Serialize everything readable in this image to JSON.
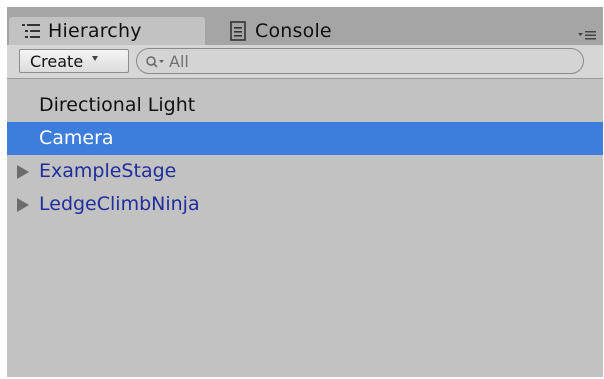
{
  "tabs": [
    {
      "label": "Hierarchy",
      "icon": "list-icon",
      "active": true
    },
    {
      "label": "Console",
      "icon": "console-icon",
      "active": false
    }
  ],
  "panel_menu": {
    "icon": "panel-menu-icon"
  },
  "toolbar": {
    "create_label": "Create",
    "search": {
      "placeholder": "All",
      "value": "",
      "icon": "search-icon"
    }
  },
  "tree": [
    {
      "label": "Directional Light",
      "state": "normal",
      "expandable": false
    },
    {
      "label": "Camera",
      "state": "selected",
      "expandable": false
    },
    {
      "label": "ExampleStage",
      "state": "prefab",
      "expandable": true
    },
    {
      "label": "LedgeClimbNinja",
      "state": "prefab",
      "expandable": true
    }
  ],
  "colors": {
    "panel_bg": "#c2c2c2",
    "tabstrip_bg": "#a5a5a5",
    "selection": "#3d7ddb",
    "prefab_text": "#1f2e9c"
  }
}
